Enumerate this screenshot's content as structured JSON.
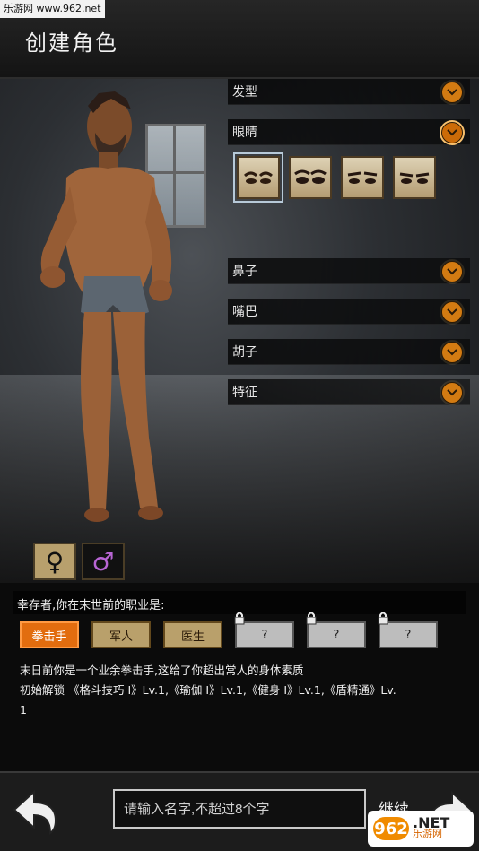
{
  "watermark": "乐游网 www.962.net",
  "title": "创建角色",
  "options": [
    {
      "label": "发型",
      "icon": "chevron-down-icon"
    },
    {
      "label": "眼睛",
      "icon": "chevron-down-icon",
      "active": true
    },
    {
      "label": "鼻子",
      "icon": "chevron-down-icon"
    },
    {
      "label": "嘴巴",
      "icon": "chevron-down-icon"
    },
    {
      "label": "胡子",
      "icon": "chevron-down-icon"
    },
    {
      "label": "特征",
      "icon": "chevron-down-icon"
    }
  ],
  "eye_options": {
    "count": 4,
    "selected_index": 0
  },
  "gender": {
    "female_symbol": "♀",
    "male_symbol": "♂"
  },
  "question": "幸存者,你在末世前的职业是:",
  "professions": [
    {
      "label": "拳击手",
      "selected": true
    },
    {
      "label": "军人"
    },
    {
      "label": "医生"
    },
    {
      "label": "?",
      "locked": true
    },
    {
      "label": "?",
      "locked": true
    },
    {
      "label": "?",
      "locked": true
    }
  ],
  "description": {
    "line1": "末日前你是一个业余拳击手,这给了你超出常人的身体素质",
    "line2": "初始解锁 《格斗技巧 I》Lv.1,《瑜伽 I》Lv.1,《健身 I》Lv.1,《盾精通》Lv.",
    "line3": "1"
  },
  "name_input": {
    "placeholder": "请输入名字,不超过8个字",
    "value": ""
  },
  "continue_label": "继续",
  "logo": {
    "mark": "962",
    "text_main": ".NET",
    "text_sub": "乐游网"
  },
  "colors": {
    "accent": "#e26d0f",
    "lock_gray": "#bdbdbd",
    "panel_tan": "#b9a06b"
  }
}
